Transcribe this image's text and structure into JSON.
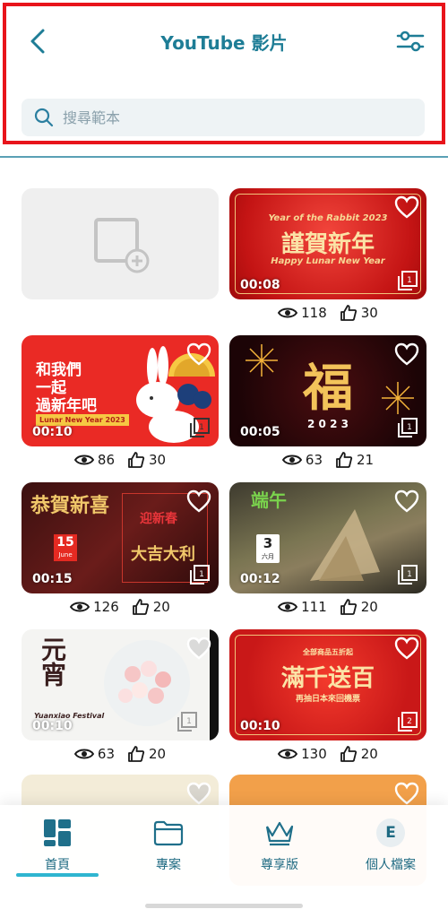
{
  "header": {
    "title": "YouTube 影片",
    "search_placeholder": "搜尋範本"
  },
  "cards": [
    {
      "id": "add",
      "type": "add"
    },
    {
      "duration": "00:08",
      "views": "118",
      "likes": "30",
      "line1": "Year of the Rabbit 2023",
      "line2": "謹賀新年",
      "line3": "Happy Lunar New Year"
    },
    {
      "duration": "00:10",
      "views": "86",
      "likes": "30",
      "line1": "和我們",
      "line2": "一起",
      "line3": "過新年吧",
      "tag": "Lunar New Year 2023"
    },
    {
      "duration": "00:05",
      "views": "63",
      "likes": "21",
      "line1": "福",
      "line2": "2 0 2 3"
    },
    {
      "duration": "00:15",
      "views": "126",
      "likes": "20",
      "line1": "恭賀新喜",
      "line2": "迎新春",
      "line3": "大吉大利",
      "date": "15",
      "month": "June"
    },
    {
      "duration": "00:12",
      "views": "111",
      "likes": "20",
      "line1": "端午",
      "date": "3",
      "month": "六月"
    },
    {
      "duration": "00:10",
      "views": "63",
      "likes": "20",
      "line1": "元宵",
      "line2": "Yuanxiao Festival"
    },
    {
      "duration": "00:10",
      "views": "130",
      "likes": "20",
      "line1": "全部商品五折起",
      "line2": "滿千送百",
      "line3": "再抽日本來回機票"
    }
  ],
  "nav": [
    {
      "label": "首頁",
      "icon": "home-grid-icon"
    },
    {
      "label": "專案",
      "icon": "folder-icon"
    },
    {
      "label": "尊享版",
      "icon": "crown-icon"
    },
    {
      "label": "個人檔案",
      "icon": "profile-icon",
      "initial": "E"
    }
  ],
  "colors": {
    "accent": "#1e7d96",
    "highlight": "#e8141b",
    "indicator": "#2fb5d0"
  }
}
